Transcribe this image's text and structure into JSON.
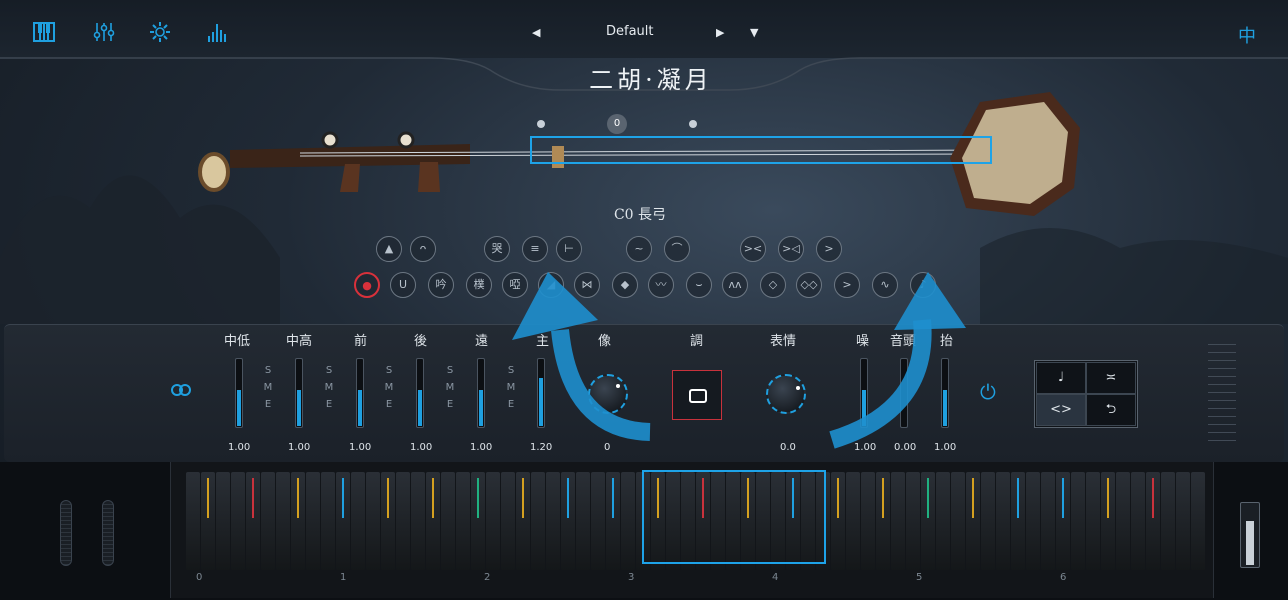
{
  "topbar": {
    "icons": [
      "piano-icon",
      "mixer-icon",
      "settings-gear-icon",
      "spectrum-icon"
    ],
    "preset_prev": "◀",
    "preset_name": "Default",
    "preset_next": "▶",
    "preset_menu": "▼",
    "language": "中"
  },
  "title": "二胡·凝月",
  "stage": {
    "octave_shift": "0",
    "articulation_name": "C0 長弓"
  },
  "articulations_row1": [
    {
      "name": "art-up",
      "label": "▲"
    },
    {
      "name": "art-harmonic",
      "label": "ᴖ"
    },
    {
      "name": "art-cry",
      "label": "哭"
    },
    {
      "name": "art-tremolo",
      "label": "≡"
    },
    {
      "name": "art-stop",
      "label": "⊢"
    },
    {
      "name": "art-slide-down",
      "label": "~"
    },
    {
      "name": "art-slide-up",
      "label": "⌒"
    },
    {
      "name": "art-cresc",
      "label": "><"
    },
    {
      "name": "art-swell",
      "label": ">◁"
    },
    {
      "name": "art-accent",
      "label": ">"
    }
  ],
  "articulations_row2": [
    {
      "name": "art-record",
      "label": "●",
      "active": true
    },
    {
      "name": "art-turn",
      "label": "U"
    },
    {
      "name": "art-sing",
      "label": "吟"
    },
    {
      "name": "art-mood",
      "label": "樸"
    },
    {
      "name": "art-mute",
      "label": "啞"
    },
    {
      "name": "art-short",
      "label": "◢"
    },
    {
      "name": "art-bound",
      "label": "⋈"
    },
    {
      "name": "art-trill",
      "label": "◆"
    },
    {
      "name": "art-vib",
      "label": "〰"
    },
    {
      "name": "art-dip",
      "label": "⌣"
    },
    {
      "name": "art-wave",
      "label": "ᴧᴧ"
    },
    {
      "name": "art-dyn",
      "label": "◇"
    },
    {
      "name": "art-dyn2",
      "label": "◇◇"
    },
    {
      "name": "art-decresc",
      "label": ">"
    },
    {
      "name": "art-trem2",
      "label": "∿"
    },
    {
      "name": "art-grace",
      "label": "♪"
    }
  ],
  "mixer": {
    "channels": [
      {
        "label": "中低",
        "value": "1.00",
        "level": 0.55,
        "sme": [
          "S",
          "M",
          "E"
        ]
      },
      {
        "label": "中高",
        "value": "1.00",
        "level": 0.55,
        "sme": [
          "S",
          "M",
          "E"
        ]
      },
      {
        "label": "前",
        "value": "1.00",
        "level": 0.55,
        "sme": [
          "S",
          "M",
          "E"
        ]
      },
      {
        "label": "後",
        "value": "1.00",
        "level": 0.55,
        "sme": [
          "S",
          "M",
          "E"
        ]
      },
      {
        "label": "遠",
        "value": "1.00",
        "level": 0.55,
        "sme": [
          "S",
          "M",
          "E"
        ]
      },
      {
        "label": "主",
        "value": "1.20",
        "level": 0.72
      }
    ],
    "knob_left": {
      "label": "像",
      "value": "0"
    },
    "direction": {
      "label": "調"
    },
    "knob_right": {
      "label": "表情",
      "value": "0.0"
    },
    "right_faders": [
      {
        "label": "噪",
        "value": "1.00",
        "level": 0.55
      },
      {
        "label": "音頭",
        "value": "0.00",
        "level": 0.0
      },
      {
        "label": "抬",
        "value": "1.00",
        "level": 0.55
      }
    ]
  },
  "modes": {
    "note": "♩",
    "legato": "≍",
    "dynamic": "<>",
    "repeat": "⮌"
  },
  "keyboard": {
    "octaves": [
      "0",
      "1",
      "2",
      "3",
      "4",
      "5",
      "6"
    ]
  }
}
